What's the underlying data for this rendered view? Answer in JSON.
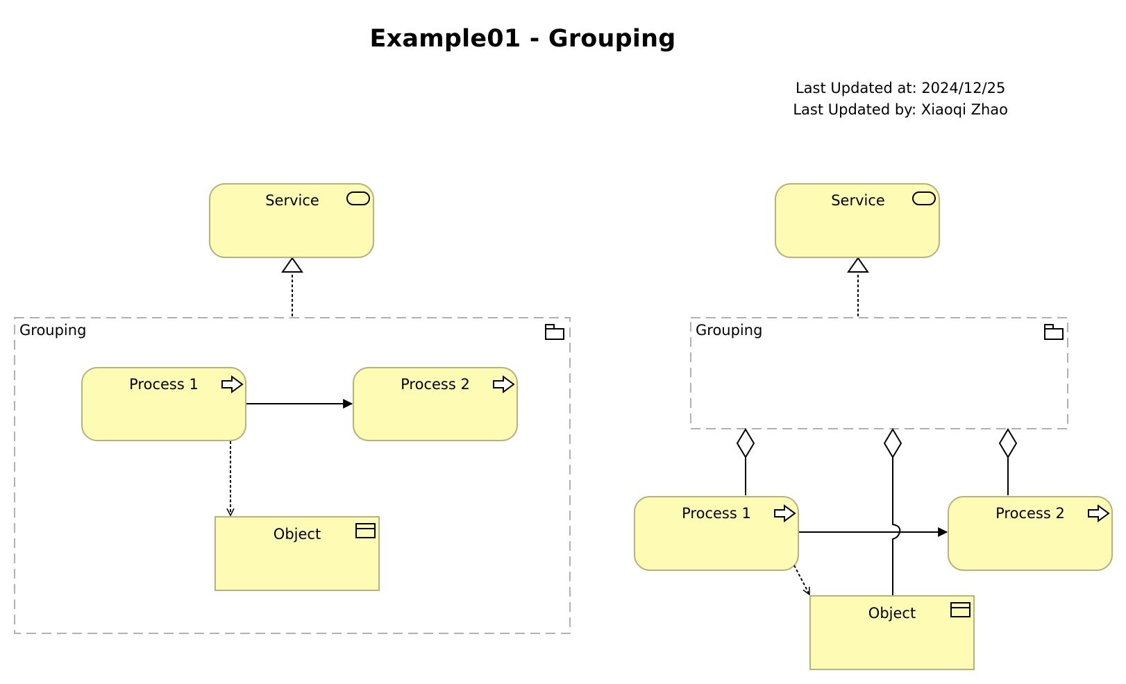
{
  "title": "Example01 - Grouping",
  "meta": {
    "updated_at": "Last Updated at: 2024/12/25",
    "updated_by": "Last Updated by: Xiaoqi Zhao"
  },
  "colors": {
    "element_fill": "#fefcb4",
    "element_stroke": "#b5b27e",
    "group_stroke": "#b0b0b0",
    "line": "#000000"
  },
  "left_diagram": {
    "service": {
      "label": "Service",
      "icon": "service-icon"
    },
    "grouping": {
      "label": "Grouping",
      "icon": "folder-icon"
    },
    "process1": {
      "label": "Process 1",
      "icon": "process-arrow-icon"
    },
    "process2": {
      "label": "Process 2",
      "icon": "process-arrow-icon"
    },
    "object": {
      "label": "Object",
      "icon": "object-icon"
    },
    "relations": [
      {
        "from": "grouping",
        "to": "service",
        "type": "realization"
      },
      {
        "from": "process1",
        "to": "process2",
        "type": "triggering"
      },
      {
        "from": "process1",
        "to": "object",
        "type": "access"
      }
    ]
  },
  "right_diagram": {
    "service": {
      "label": "Service",
      "icon": "service-icon"
    },
    "grouping": {
      "label": "Grouping",
      "icon": "folder-icon"
    },
    "process1": {
      "label": "Process 1",
      "icon": "process-arrow-icon"
    },
    "process2": {
      "label": "Process 2",
      "icon": "process-arrow-icon"
    },
    "object": {
      "label": "Object",
      "icon": "object-icon"
    },
    "relations": [
      {
        "from": "grouping",
        "to": "service",
        "type": "realization"
      },
      {
        "from": "grouping",
        "to": "process1",
        "type": "aggregation"
      },
      {
        "from": "grouping",
        "to": "object",
        "type": "aggregation"
      },
      {
        "from": "grouping",
        "to": "process2",
        "type": "aggregation"
      },
      {
        "from": "process1",
        "to": "process2",
        "type": "triggering"
      },
      {
        "from": "process1",
        "to": "object",
        "type": "access"
      }
    ]
  }
}
